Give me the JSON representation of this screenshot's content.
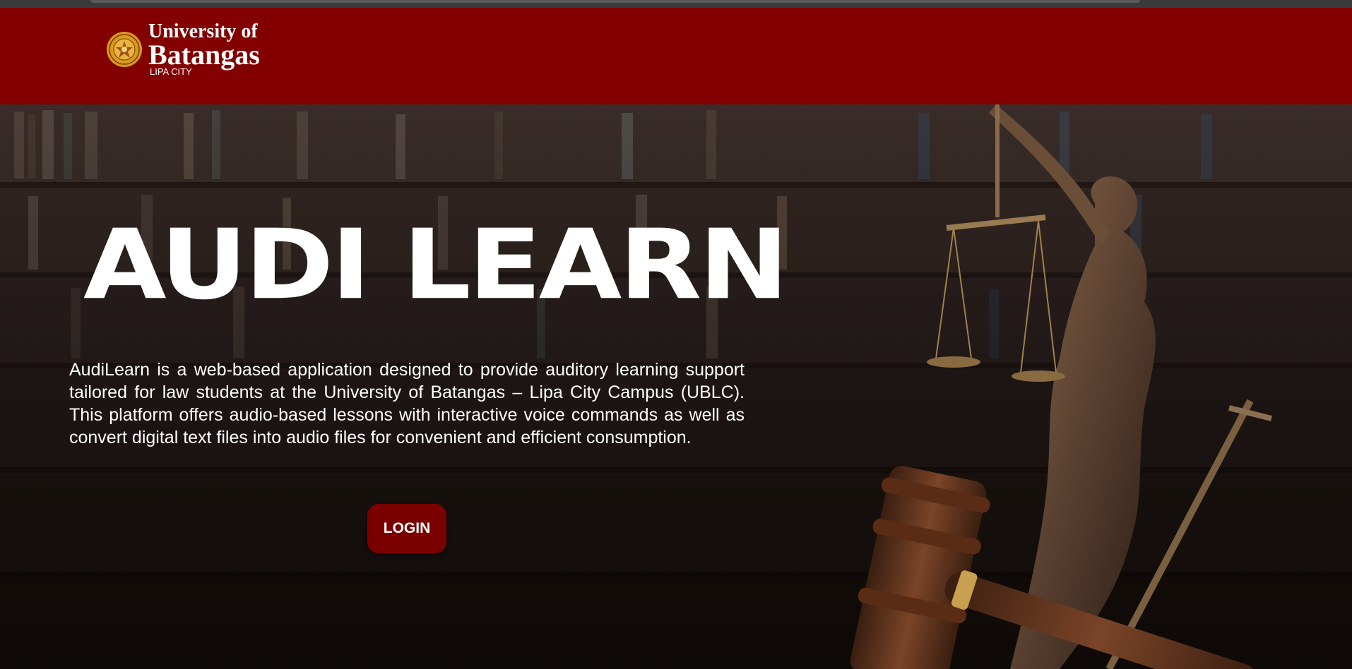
{
  "header": {
    "logo": {
      "line1": "University of",
      "line2": "Batangas",
      "line3": "LIPA CITY"
    },
    "background_color": "#820000"
  },
  "hero": {
    "title": "AUDI LEARN",
    "description": "AudiLearn is a web-based application designed to provide auditory learning support tailored for law students at the University of Batangas – Lipa City Campus (UBLC). This platform offers audio-based lessons with interactive voice commands as well as convert digital text files into audio files for convenient and efficient consumption.",
    "login_label": "LOGIN",
    "button_color": "#7a0000",
    "background_image": "law-library-with-lady-justice-and-gavel"
  },
  "icons": {
    "seal": "university-seal-icon"
  }
}
